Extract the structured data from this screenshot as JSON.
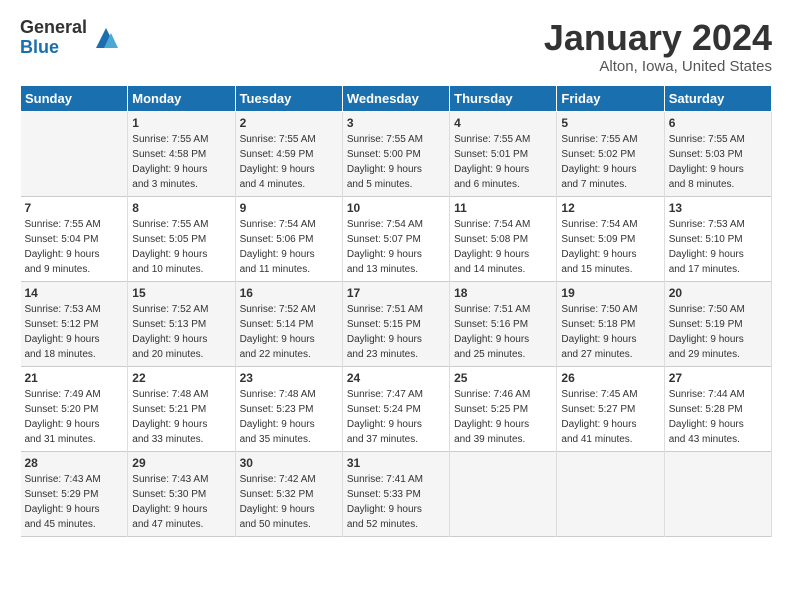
{
  "logo": {
    "general": "General",
    "blue": "Blue"
  },
  "title": "January 2024",
  "subtitle": "Alton, Iowa, United States",
  "days_of_week": [
    "Sunday",
    "Monday",
    "Tuesday",
    "Wednesday",
    "Thursday",
    "Friday",
    "Saturday"
  ],
  "weeks": [
    [
      {
        "num": "",
        "info": ""
      },
      {
        "num": "1",
        "info": "Sunrise: 7:55 AM\nSunset: 4:58 PM\nDaylight: 9 hours\nand 3 minutes."
      },
      {
        "num": "2",
        "info": "Sunrise: 7:55 AM\nSunset: 4:59 PM\nDaylight: 9 hours\nand 4 minutes."
      },
      {
        "num": "3",
        "info": "Sunrise: 7:55 AM\nSunset: 5:00 PM\nDaylight: 9 hours\nand 5 minutes."
      },
      {
        "num": "4",
        "info": "Sunrise: 7:55 AM\nSunset: 5:01 PM\nDaylight: 9 hours\nand 6 minutes."
      },
      {
        "num": "5",
        "info": "Sunrise: 7:55 AM\nSunset: 5:02 PM\nDaylight: 9 hours\nand 7 minutes."
      },
      {
        "num": "6",
        "info": "Sunrise: 7:55 AM\nSunset: 5:03 PM\nDaylight: 9 hours\nand 8 minutes."
      }
    ],
    [
      {
        "num": "7",
        "info": "Sunrise: 7:55 AM\nSunset: 5:04 PM\nDaylight: 9 hours\nand 9 minutes."
      },
      {
        "num": "8",
        "info": "Sunrise: 7:55 AM\nSunset: 5:05 PM\nDaylight: 9 hours\nand 10 minutes."
      },
      {
        "num": "9",
        "info": "Sunrise: 7:54 AM\nSunset: 5:06 PM\nDaylight: 9 hours\nand 11 minutes."
      },
      {
        "num": "10",
        "info": "Sunrise: 7:54 AM\nSunset: 5:07 PM\nDaylight: 9 hours\nand 13 minutes."
      },
      {
        "num": "11",
        "info": "Sunrise: 7:54 AM\nSunset: 5:08 PM\nDaylight: 9 hours\nand 14 minutes."
      },
      {
        "num": "12",
        "info": "Sunrise: 7:54 AM\nSunset: 5:09 PM\nDaylight: 9 hours\nand 15 minutes."
      },
      {
        "num": "13",
        "info": "Sunrise: 7:53 AM\nSunset: 5:10 PM\nDaylight: 9 hours\nand 17 minutes."
      }
    ],
    [
      {
        "num": "14",
        "info": "Sunrise: 7:53 AM\nSunset: 5:12 PM\nDaylight: 9 hours\nand 18 minutes."
      },
      {
        "num": "15",
        "info": "Sunrise: 7:52 AM\nSunset: 5:13 PM\nDaylight: 9 hours\nand 20 minutes."
      },
      {
        "num": "16",
        "info": "Sunrise: 7:52 AM\nSunset: 5:14 PM\nDaylight: 9 hours\nand 22 minutes."
      },
      {
        "num": "17",
        "info": "Sunrise: 7:51 AM\nSunset: 5:15 PM\nDaylight: 9 hours\nand 23 minutes."
      },
      {
        "num": "18",
        "info": "Sunrise: 7:51 AM\nSunset: 5:16 PM\nDaylight: 9 hours\nand 25 minutes."
      },
      {
        "num": "19",
        "info": "Sunrise: 7:50 AM\nSunset: 5:18 PM\nDaylight: 9 hours\nand 27 minutes."
      },
      {
        "num": "20",
        "info": "Sunrise: 7:50 AM\nSunset: 5:19 PM\nDaylight: 9 hours\nand 29 minutes."
      }
    ],
    [
      {
        "num": "21",
        "info": "Sunrise: 7:49 AM\nSunset: 5:20 PM\nDaylight: 9 hours\nand 31 minutes."
      },
      {
        "num": "22",
        "info": "Sunrise: 7:48 AM\nSunset: 5:21 PM\nDaylight: 9 hours\nand 33 minutes."
      },
      {
        "num": "23",
        "info": "Sunrise: 7:48 AM\nSunset: 5:23 PM\nDaylight: 9 hours\nand 35 minutes."
      },
      {
        "num": "24",
        "info": "Sunrise: 7:47 AM\nSunset: 5:24 PM\nDaylight: 9 hours\nand 37 minutes."
      },
      {
        "num": "25",
        "info": "Sunrise: 7:46 AM\nSunset: 5:25 PM\nDaylight: 9 hours\nand 39 minutes."
      },
      {
        "num": "26",
        "info": "Sunrise: 7:45 AM\nSunset: 5:27 PM\nDaylight: 9 hours\nand 41 minutes."
      },
      {
        "num": "27",
        "info": "Sunrise: 7:44 AM\nSunset: 5:28 PM\nDaylight: 9 hours\nand 43 minutes."
      }
    ],
    [
      {
        "num": "28",
        "info": "Sunrise: 7:43 AM\nSunset: 5:29 PM\nDaylight: 9 hours\nand 45 minutes."
      },
      {
        "num": "29",
        "info": "Sunrise: 7:43 AM\nSunset: 5:30 PM\nDaylight: 9 hours\nand 47 minutes."
      },
      {
        "num": "30",
        "info": "Sunrise: 7:42 AM\nSunset: 5:32 PM\nDaylight: 9 hours\nand 50 minutes."
      },
      {
        "num": "31",
        "info": "Sunrise: 7:41 AM\nSunset: 5:33 PM\nDaylight: 9 hours\nand 52 minutes."
      },
      {
        "num": "",
        "info": ""
      },
      {
        "num": "",
        "info": ""
      },
      {
        "num": "",
        "info": ""
      }
    ]
  ]
}
